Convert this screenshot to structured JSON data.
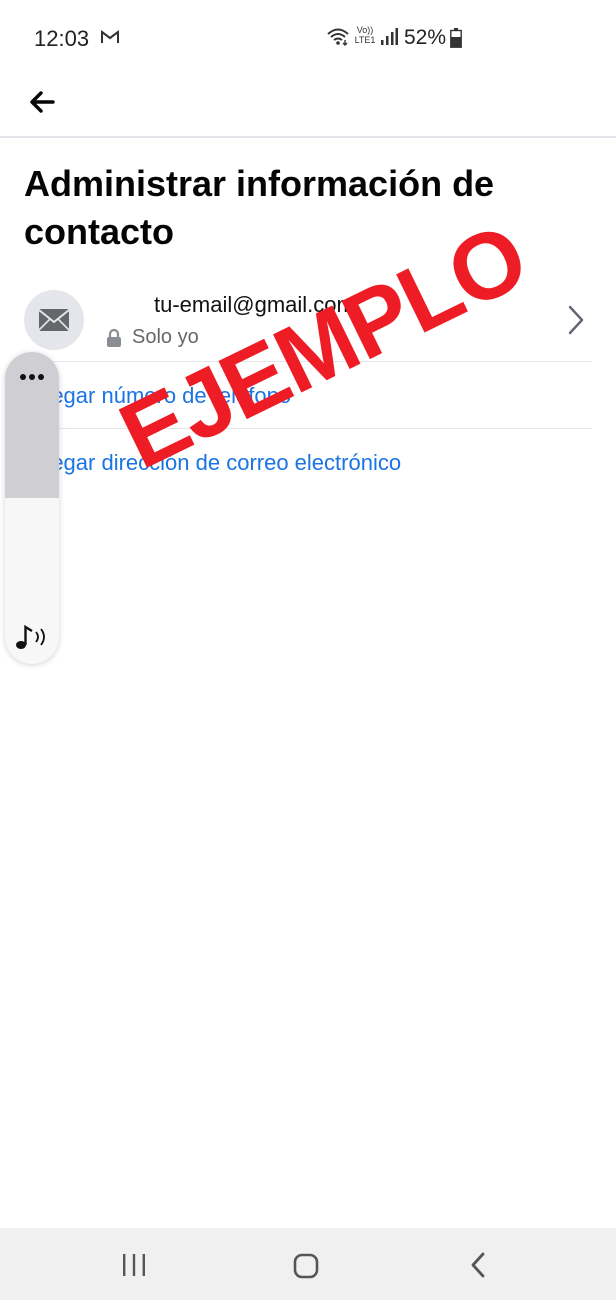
{
  "status_bar": {
    "time": "12:03",
    "volte_top": "Vo))",
    "volte_bottom": "LTE1",
    "battery": "52%"
  },
  "header": {
    "back_icon": "arrow-left-icon"
  },
  "page": {
    "title": "Administrar información de contacto"
  },
  "contact": {
    "icon": "envelope-icon",
    "email": "tu-email@gmail.com",
    "privacy": "Solo yo",
    "privacy_icon": "lock-icon"
  },
  "actions": {
    "add_phone": "regar número de teléfono",
    "add_email": "regar dirección de correo electrónico"
  },
  "watermark": "EJEMPLO",
  "colors": {
    "link": "#1b74e4",
    "watermark": "#ee1c25",
    "divider": "#e4e6eb"
  }
}
